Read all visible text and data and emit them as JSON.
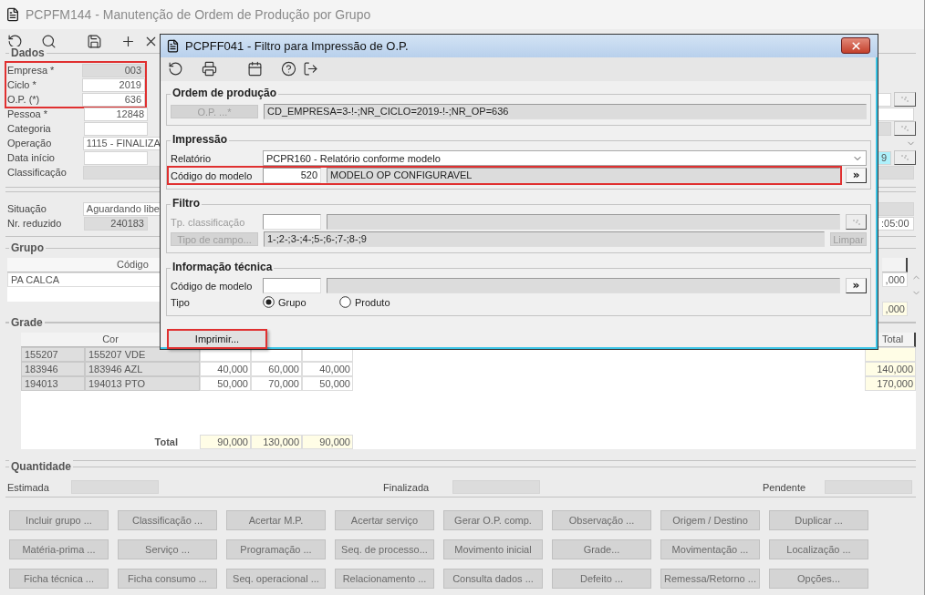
{
  "window": {
    "title": "PCPFM144 - Manutenção de Ordem de Produção por Grupo"
  },
  "toolbar": [
    {
      "kind": "undo"
    },
    {
      "kind": "search"
    },
    {
      "kind": "save"
    },
    {
      "kind": "add"
    },
    {
      "kind": "delete"
    }
  ],
  "dados": {
    "legend": "Dados",
    "fields": [
      {
        "label": "Empresa *",
        "value": "003",
        "kind": "number",
        "readonly": true,
        "highlighted": true
      },
      {
        "label": "Ciclo *",
        "value": "2019",
        "kind": "number",
        "readonly": false,
        "highlighted": true
      },
      {
        "label": "O.P. (*)",
        "value": "636",
        "kind": "number",
        "readonly": false,
        "highlighted": true
      },
      {
        "label": "Pessoa *",
        "value": "12848",
        "kind": "number",
        "readonly": false,
        "highlighted": false
      },
      {
        "label": "Categoria",
        "kind": "code",
        "readonly": false,
        "highlighted": false
      },
      {
        "label": "Operação",
        "value": "1115 - FINALIZA",
        "kind": "text",
        "readonly": false,
        "highlighted": false
      },
      {
        "label": "Data início",
        "kind": "code",
        "readonly": false,
        "highlighted": false
      },
      {
        "label": "Classificação",
        "kind": "text",
        "readonly": true,
        "highlighted": false
      }
    ],
    "edge": [
      {
        "kind": "none"
      },
      {
        "kind": "none"
      },
      {
        "kind": "lookup"
      },
      {
        "kind": "field"
      },
      {
        "kind": "readonly_lookup"
      },
      {
        "kind": "dropdown"
      },
      {
        "kind": "active_lookup",
        "value": "9"
      },
      {
        "kind": "readonly"
      }
    ]
  },
  "situacao": {
    "fields": [
      {
        "label": "Situação",
        "value": "Aguardando libe",
        "kind": "text",
        "readonly": false
      },
      {
        "label": "Nr. reduzido",
        "value": "240183",
        "kind": "number",
        "readonly": true
      }
    ],
    "edge": [
      {
        "kind": "readonly"
      },
      {
        "kind": "field",
        "value": ":05:00"
      }
    ]
  },
  "grupo": {
    "legend": "Grupo",
    "header": "Código",
    "rows": [
      "PA CALCA"
    ],
    "edge": [
      {
        "kind": "header"
      },
      {
        "kind": "number",
        "value": ",000"
      },
      {
        "kind": "none"
      },
      {
        "kind": "total",
        "value": ",000"
      }
    ]
  },
  "grade": {
    "legend": "Grade",
    "header": "Cor",
    "total_header": "Total",
    "rows": [
      {
        "code": "155207",
        "cor": "155207 VDE"
      },
      {
        "code": "183946",
        "cor": "183946 AZL",
        "values": [
          "40,000",
          "60,000",
          "40,000"
        ],
        "total": "140,000"
      },
      {
        "code": "194013",
        "cor": "194013 PTO",
        "values": [
          "50,000",
          "70,000",
          "50,000"
        ],
        "total": "170,000"
      }
    ],
    "total_label": "Total",
    "totals": [
      "90,000",
      "130,000",
      "90,000"
    ]
  },
  "quantidade": {
    "legend": "Quantidade",
    "fields": [
      {
        "label": "Estimada"
      },
      {
        "label": "Finalizada"
      },
      {
        "label": "Pendente"
      }
    ]
  },
  "buttons": [
    "Incluir grupo ...",
    "Classificação ...",
    "Acertar M.P.",
    "Acertar serviço",
    "Gerar O.P. comp.",
    "Observação ...",
    "Origem / Destino",
    "Duplicar ...",
    "Matéria-prima ...",
    "Serviço ...",
    "Programação ...",
    "Seq. de processo...",
    "Movimento inicial",
    "Grade...",
    "Movimentação ...",
    "Localização ...",
    "Ficha técnica ...",
    "Ficha consumo ...",
    "Seq. operacional ...",
    "Relacionamento ...",
    "Consulta dados ...",
    "Defeito ...",
    "Remessa/Retorno ...",
    "Opções..."
  ],
  "dialog": {
    "title": "PCPFF041 - Filtro para Impressão de O.P.",
    "toolbar": [
      {
        "kind": "undo"
      },
      {
        "kind": "print"
      },
      {
        "kind": "calendar"
      },
      {
        "kind": "help"
      },
      {
        "kind": "exit"
      }
    ],
    "ordem": {
      "legend": "Ordem de produção",
      "button": {
        "label": "O.P. ...*",
        "disabled": true
      },
      "value": "CD_EMPRESA=3-!-;NR_CICLO=2019-!-;NR_OP=636"
    },
    "impressao": {
      "legend": "Impressão",
      "relatorio": {
        "label": "Relatório",
        "value": "PCPR160 - Relatório conforme modelo"
      },
      "modelo": {
        "label": "Código do modelo",
        "code": "520",
        "description": "MODELO OP CONFIGURAVEL",
        "button": "»",
        "highlighted": true
      }
    },
    "filtro": {
      "legend": "Filtro",
      "classificacao": {
        "label": "Tp. classificação",
        "disabled": true
      },
      "tipo_campo": {
        "label": "Tipo de campo...",
        "disabled": true,
        "value": "1-;2-;3-;4-;5-;6-;7-;8-;9",
        "clear": "Limpar",
        "clear_disabled": true
      }
    },
    "tecnica": {
      "legend": "Informação técnica",
      "modelo_label": "Código de modelo",
      "button": "»",
      "tipo_label": "Tipo",
      "options": [
        {
          "label": "Grupo",
          "selected": true
        },
        {
          "label": "Produto",
          "selected": false
        }
      ]
    },
    "print_button": {
      "label": "Imprimir...",
      "highlighted": true
    }
  }
}
